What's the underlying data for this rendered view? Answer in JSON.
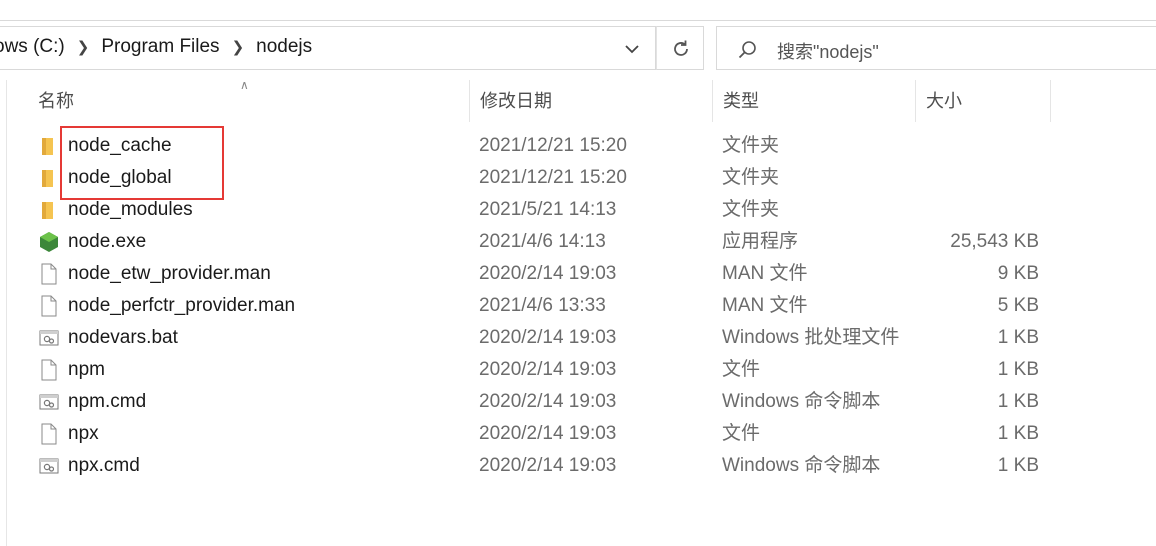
{
  "address_bar": {
    "crumbs": [
      "ows (C:)",
      "Program Files",
      "nodejs"
    ]
  },
  "search": {
    "placeholder": "搜索\"nodejs\""
  },
  "columns": {
    "name": "名称",
    "date": "修改日期",
    "type": "类型",
    "size": "大小"
  },
  "files": [
    {
      "name": "node_cache",
      "date": "2021/12/21 15:20",
      "type": "文件夹",
      "size": "",
      "icon": "folder-icon"
    },
    {
      "name": "node_global",
      "date": "2021/12/21 15:20",
      "type": "文件夹",
      "size": "",
      "icon": "folder-icon"
    },
    {
      "name": "node_modules",
      "date": "2021/5/21 14:13",
      "type": "文件夹",
      "size": "",
      "icon": "folder-icon"
    },
    {
      "name": "node.exe",
      "date": "2021/4/6 14:13",
      "type": "应用程序",
      "size": "25,543 KB",
      "icon": "nodejs-exe-icon"
    },
    {
      "name": "node_etw_provider.man",
      "date": "2020/2/14 19:03",
      "type": "MAN 文件",
      "size": "9 KB",
      "icon": "file-icon"
    },
    {
      "name": "node_perfctr_provider.man",
      "date": "2021/4/6 13:33",
      "type": "MAN 文件",
      "size": "5 KB",
      "icon": "file-icon"
    },
    {
      "name": "nodevars.bat",
      "date": "2020/2/14 19:03",
      "type": "Windows 批处理文件",
      "size": "1 KB",
      "icon": "batch-file-icon"
    },
    {
      "name": "npm",
      "date": "2020/2/14 19:03",
      "type": "文件",
      "size": "1 KB",
      "icon": "file-icon"
    },
    {
      "name": "npm.cmd",
      "date": "2020/2/14 19:03",
      "type": "Windows 命令脚本",
      "size": "1 KB",
      "icon": "batch-file-icon"
    },
    {
      "name": "npx",
      "date": "2020/2/14 19:03",
      "type": "文件",
      "size": "1 KB",
      "icon": "file-icon"
    },
    {
      "name": "npx.cmd",
      "date": "2020/2/14 19:03",
      "type": "Windows 命令脚本",
      "size": "1 KB",
      "icon": "batch-file-icon"
    }
  ],
  "colors": {
    "highlight_border": "#e53935",
    "folder": "#f2c14e",
    "node_green": "#3c873a"
  }
}
